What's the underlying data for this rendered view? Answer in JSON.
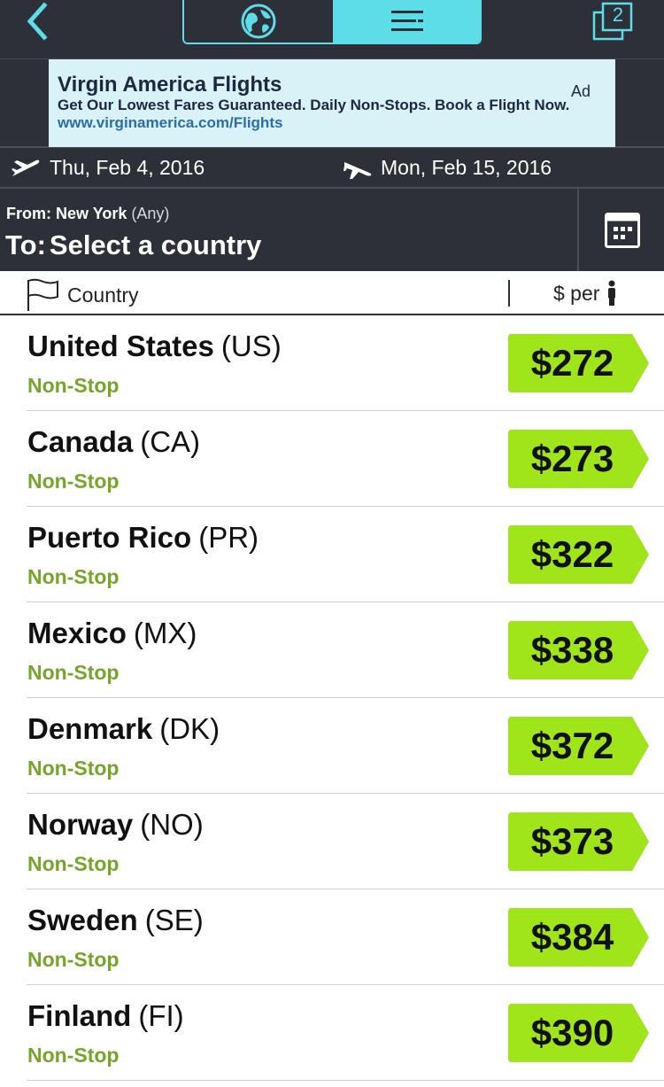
{
  "topbar": {
    "back_icon": "chevron-left-icon",
    "view_tabs": [
      {
        "name": "globe-view",
        "icon": "globe-icon",
        "active": false
      },
      {
        "name": "list-view",
        "icon": "list-icon",
        "active": true
      }
    ],
    "tab_count": "2"
  },
  "ad": {
    "title": "Virgin America Flights",
    "body": "Get Our Lowest Fares Guaranteed. Daily Non-Stops. Book a Flight Now.",
    "url": "www.virginamerica.com/Flights",
    "label": "Ad"
  },
  "dates": {
    "departure": "Thu, Feb 4, 2016",
    "return": "Mon, Feb 15, 2016"
  },
  "route": {
    "from_label": "From:",
    "from_city": "New York",
    "from_qualifier": "(Any)",
    "to_label": "To:",
    "to_value": "Select a country"
  },
  "columns": {
    "country": "Country",
    "price": "$ per"
  },
  "rows": [
    {
      "name": "United States",
      "code": "(US)",
      "stops": "Non-Stop",
      "price": "$272"
    },
    {
      "name": "Canada",
      "code": "(CA)",
      "stops": "Non-Stop",
      "price": "$273"
    },
    {
      "name": "Puerto Rico",
      "code": "(PR)",
      "stops": "Non-Stop",
      "price": "$322"
    },
    {
      "name": "Mexico",
      "code": "(MX)",
      "stops": "Non-Stop",
      "price": "$338"
    },
    {
      "name": "Denmark",
      "code": "(DK)",
      "stops": "Non-Stop",
      "price": "$372"
    },
    {
      "name": "Norway",
      "code": "(NO)",
      "stops": "Non-Stop",
      "price": "$373"
    },
    {
      "name": "Sweden",
      "code": "(SE)",
      "stops": "Non-Stop",
      "price": "$384"
    },
    {
      "name": "Finland",
      "code": "(FI)",
      "stops": "Non-Stop",
      "price": "$390"
    }
  ],
  "colors": {
    "bar": "#2d3038",
    "accent": "#5ddde8",
    "price_tag": "#9fe51a",
    "nonstop": "#77a52a"
  }
}
